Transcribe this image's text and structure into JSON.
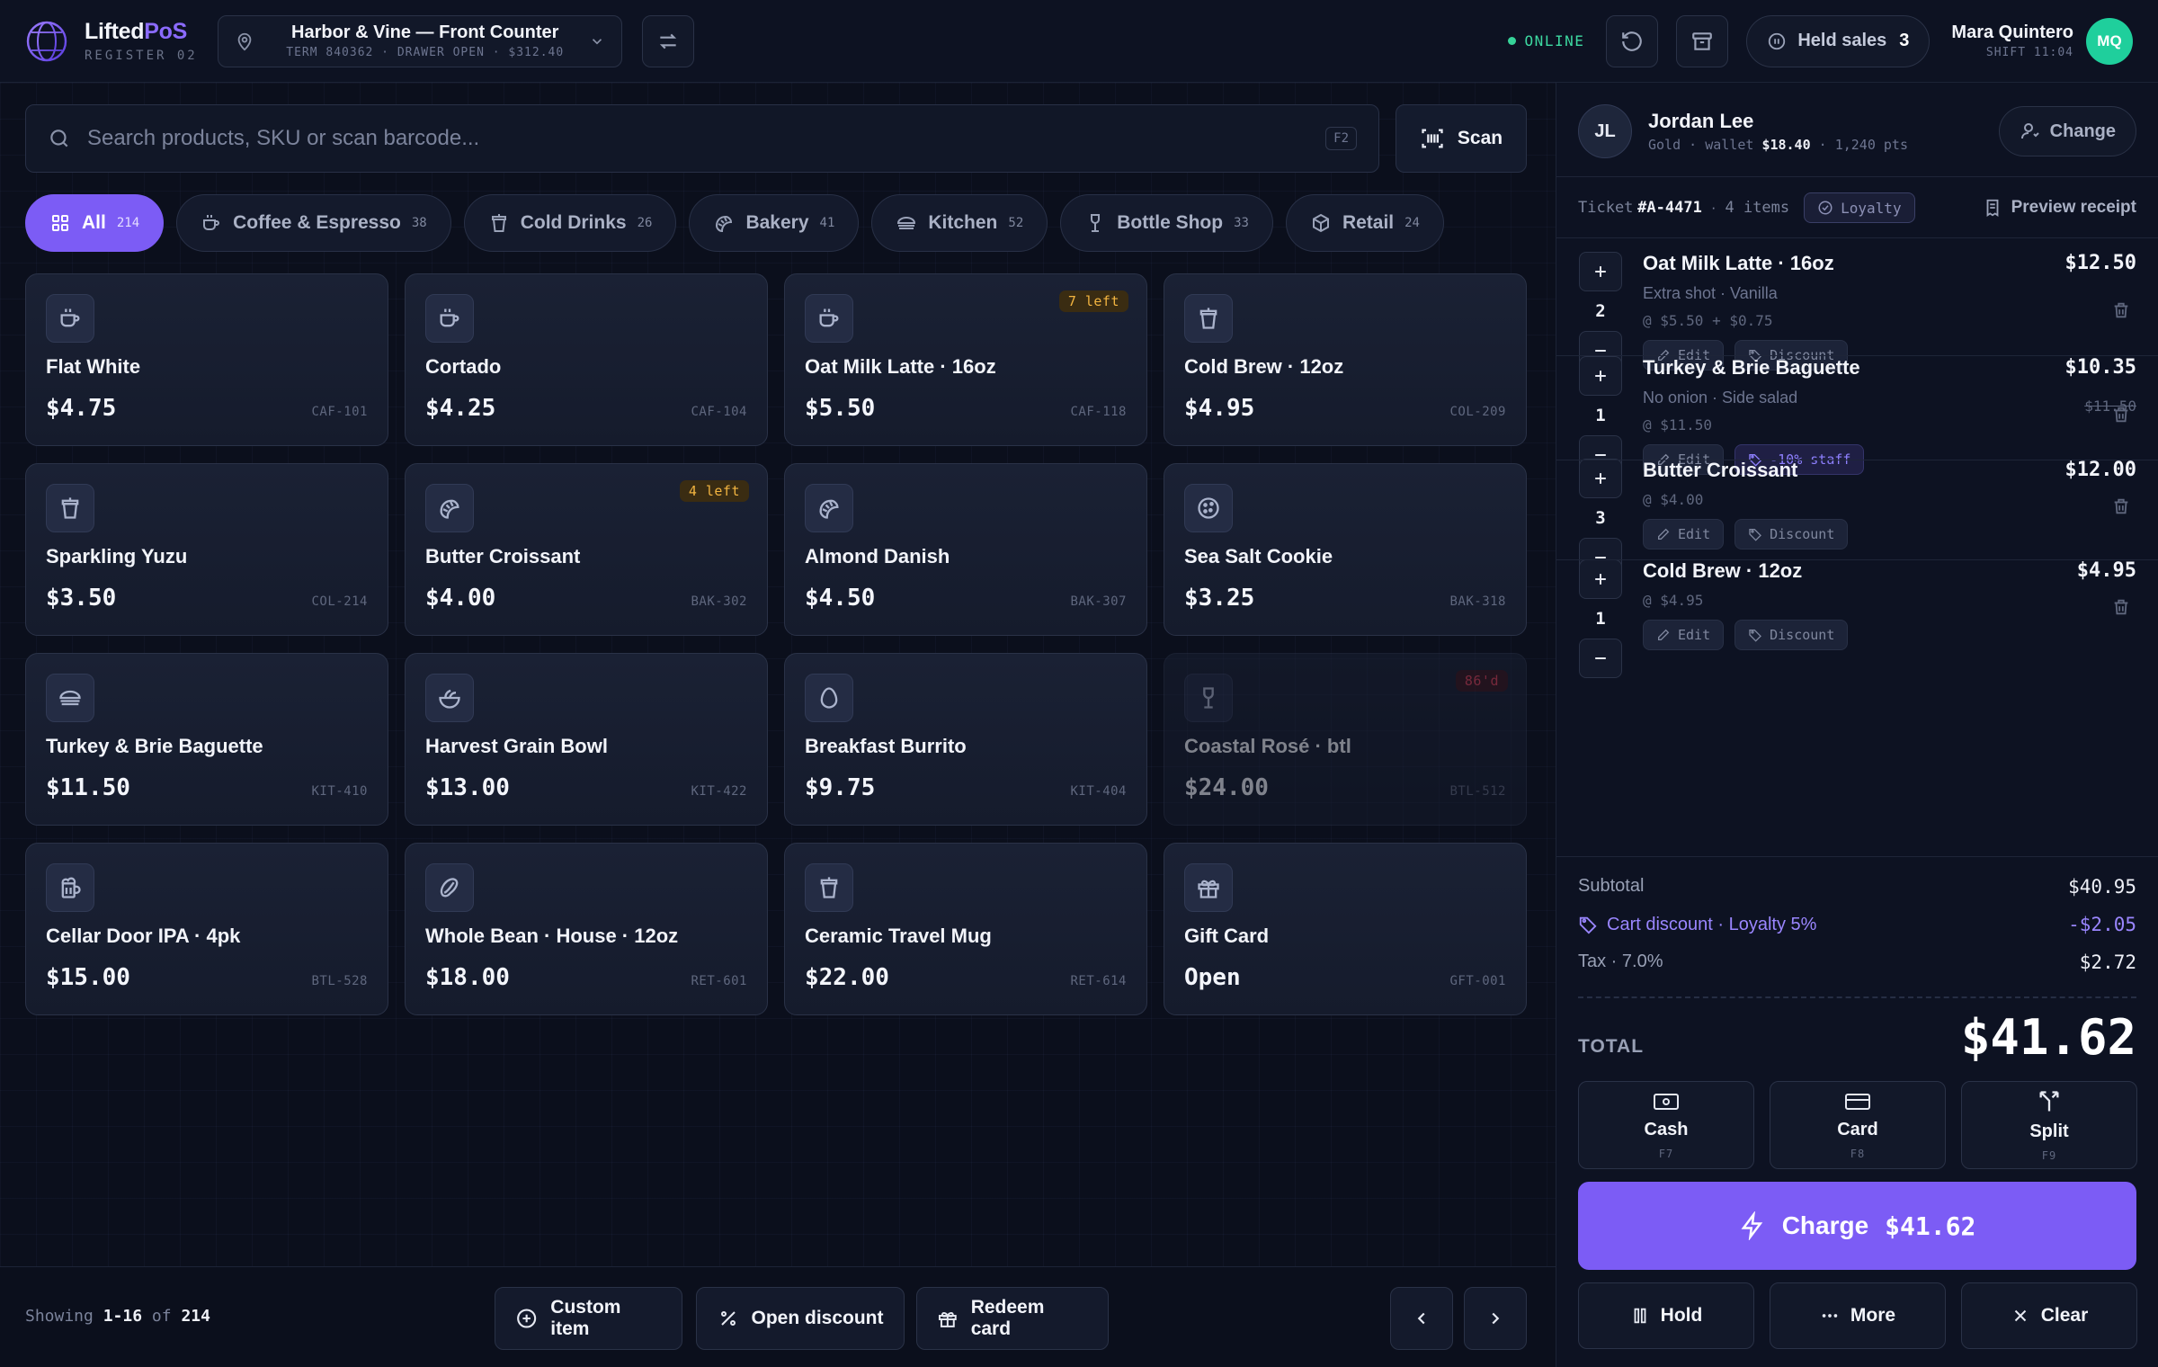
{
  "brand": {
    "name_a": "Lifted",
    "name_b": "PoS",
    "register": "REGISTER 02"
  },
  "location": {
    "title": "Harbor & Vine — Front Counter",
    "subtitle": "TERM 840362 · DRAWER OPEN · $312.40"
  },
  "status": {
    "online": "ONLINE"
  },
  "held": {
    "label": "Held sales",
    "count": "3"
  },
  "user": {
    "name": "Mara Quintero",
    "shift": "SHIFT 11:04",
    "initials": "MQ"
  },
  "search": {
    "placeholder": "Search products, SKU or scan barcode...",
    "shortcut": "F2",
    "scan_label": "Scan"
  },
  "categories": [
    {
      "label": "All",
      "count": "214",
      "icon": "grid-icon"
    },
    {
      "label": "Coffee & Espresso",
      "count": "38",
      "icon": "coffee-icon"
    },
    {
      "label": "Cold Drinks",
      "count": "26",
      "icon": "cup-icon"
    },
    {
      "label": "Bakery",
      "count": "41",
      "icon": "croissant-icon"
    },
    {
      "label": "Kitchen",
      "count": "52",
      "icon": "sandwich-icon"
    },
    {
      "label": "Bottle Shop",
      "count": "33",
      "icon": "wine-icon"
    },
    {
      "label": "Retail",
      "count": "24",
      "icon": "package-icon"
    }
  ],
  "products": [
    {
      "name": "Flat White",
      "price": "$4.75",
      "sku": "CAF-101",
      "icon": "coffee-icon"
    },
    {
      "name": "Cortado",
      "price": "$4.25",
      "sku": "CAF-104",
      "icon": "coffee-icon"
    },
    {
      "name": "Oat Milk Latte · 16oz",
      "price": "$5.50",
      "sku": "CAF-118",
      "icon": "coffee-icon",
      "badge": "7 left"
    },
    {
      "name": "Cold Brew · 12oz",
      "price": "$4.95",
      "sku": "COL-209",
      "icon": "cup-icon"
    },
    {
      "name": "Sparkling Yuzu",
      "price": "$3.50",
      "sku": "COL-214",
      "icon": "cup-icon"
    },
    {
      "name": "Butter Croissant",
      "price": "$4.00",
      "sku": "BAK-302",
      "icon": "croissant-icon",
      "badge": "4 left"
    },
    {
      "name": "Almond Danish",
      "price": "$4.50",
      "sku": "BAK-307",
      "icon": "croissant-icon"
    },
    {
      "name": "Sea Salt Cookie",
      "price": "$3.25",
      "sku": "BAK-318",
      "icon": "cookie-icon"
    },
    {
      "name": "Turkey & Brie Baguette",
      "price": "$11.50",
      "sku": "KIT-410",
      "icon": "sandwich-icon"
    },
    {
      "name": "Harvest Grain Bowl",
      "price": "$13.00",
      "sku": "KIT-422",
      "icon": "salad-icon"
    },
    {
      "name": "Breakfast Burrito",
      "price": "$9.75",
      "sku": "KIT-404",
      "icon": "egg-icon"
    },
    {
      "name": "Coastal Rosé · btl",
      "price": "$24.00",
      "sku": "BTL-512",
      "icon": "wine-icon",
      "badge": "86'd",
      "unavailable": true
    },
    {
      "name": "Cellar Door IPA · 4pk",
      "price": "$15.00",
      "sku": "BTL-528",
      "icon": "beer-icon"
    },
    {
      "name": "Whole Bean · House · 12oz",
      "price": "$18.00",
      "sku": "RET-601",
      "icon": "bean-icon"
    },
    {
      "name": "Ceramic Travel Mug",
      "price": "$22.00",
      "sku": "RET-614",
      "icon": "cup-icon"
    },
    {
      "name": "Gift Card",
      "price": "Open",
      "sku": "GFT-001",
      "icon": "gift-icon"
    }
  ],
  "footer": {
    "showing_a": "Showing",
    "showing_range": "1-16",
    "showing_of": "of",
    "showing_total": "214",
    "custom_item": "Custom item",
    "open_discount": "Open discount",
    "redeem_card": "Redeem card"
  },
  "customer": {
    "initials": "JL",
    "name": "Jordan Lee",
    "tier": "Gold",
    "wallet_label": "wallet",
    "wallet": "$18.40",
    "points": "1,240 pts",
    "change_label": "Change"
  },
  "ticket": {
    "label": "Ticket",
    "id": "#A-4471",
    "items": "4 items",
    "loyalty": "Loyalty",
    "preview": "Preview receipt"
  },
  "cart": [
    {
      "name": "Oat Milk Latte · 16oz",
      "mods": "Extra shot · Vanilla",
      "unit": "@ $5.50 + $0.75",
      "qty": "2",
      "total": "$12.50",
      "edit": "Edit",
      "discount": "Discount"
    },
    {
      "name": "Turkey & Brie Baguette",
      "mods": "No onion · Side salad",
      "unit": "@ $11.50",
      "qty": "1",
      "total": "$10.35",
      "original": "$11.50",
      "edit": "Edit",
      "discount": "-10% staff"
    },
    {
      "name": "Butter Croissant",
      "unit": "@ $4.00",
      "qty": "3",
      "total": "$12.00",
      "edit": "Edit",
      "discount": "Discount"
    },
    {
      "name": "Cold Brew · 12oz",
      "unit": "@ $4.95",
      "qty": "1",
      "total": "$4.95",
      "edit": "Edit",
      "discount": "Discount"
    }
  ],
  "totals": {
    "subtotal_label": "Subtotal",
    "subtotal": "$40.95",
    "discount_label": "Cart discount · Loyalty 5%",
    "discount": "-$2.05",
    "tax_label": "Tax · 7.0%",
    "tax": "$2.72",
    "total_label": "TOTAL",
    "total": "$41.62"
  },
  "payment": [
    {
      "label": "Cash",
      "key": "F7",
      "icon": "cash-icon"
    },
    {
      "label": "Card",
      "key": "F8",
      "icon": "card-icon"
    },
    {
      "label": "Split",
      "key": "F9",
      "icon": "split-icon"
    }
  ],
  "charge": {
    "label": "Charge",
    "amount": "$41.62"
  },
  "actions": {
    "hold": "Hold",
    "more": "More",
    "clear": "Clear"
  },
  "colors": {
    "accent": "#7c5cf5",
    "online": "#36d399",
    "warn": "#f2b440",
    "danger": "#e0425a"
  }
}
